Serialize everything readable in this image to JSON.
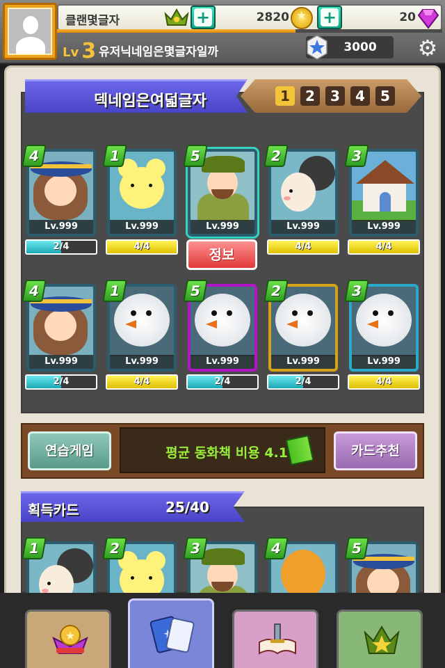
{
  "header": {
    "clan_name": "클랜몇글자",
    "gold": "2820",
    "gems": "20",
    "level_label": "Lv",
    "level": "3",
    "nickname": "유저닉네임은몇글자일까",
    "rank_points": "3000",
    "xp_progress": 0.62,
    "icons": {
      "clan": "crown-icon",
      "add": "plus-icon",
      "gold": "coin-icon",
      "gems": "gem-icon",
      "rank": "rank-star-icon",
      "settings": "gear-icon"
    }
  },
  "deck": {
    "title": "덱네임은여덟글자",
    "tabs": [
      "1",
      "2",
      "3",
      "4",
      "5"
    ],
    "active_tab": "1",
    "cards": [
      {
        "cost": "4",
        "level": "Lv.999",
        "progress": "2/4",
        "progress_value": 0.5,
        "bar": "cyan",
        "frame": "default",
        "art": "witch"
      },
      {
        "cost": "1",
        "level": "Lv.999",
        "progress": "4/4",
        "progress_value": 1.0,
        "bar": "yellow",
        "frame": "default",
        "art": "bear"
      },
      {
        "cost": "5",
        "level": "Lv.999",
        "progress": "",
        "progress_value": 0,
        "bar": "none",
        "frame": "selected",
        "art": "hunter"
      },
      {
        "cost": "2",
        "level": "Lv.999",
        "progress": "4/4",
        "progress_value": 1.0,
        "bar": "yellow",
        "frame": "default",
        "art": "goat"
      },
      {
        "cost": "3",
        "level": "Lv.999",
        "progress": "4/4",
        "progress_value": 1.0,
        "bar": "yellow",
        "frame": "default",
        "art": "house"
      },
      {
        "cost": "4",
        "level": "Lv.999",
        "progress": "2/4",
        "progress_value": 0.5,
        "bar": "cyan",
        "frame": "default",
        "art": "witch"
      },
      {
        "cost": "1",
        "level": "Lv.999",
        "progress": "4/4",
        "progress_value": 1.0,
        "bar": "yellow",
        "frame": "default",
        "art": "snowman"
      },
      {
        "cost": "5",
        "level": "Lv.999",
        "progress": "2/4",
        "progress_value": 0.5,
        "bar": "cyan",
        "frame": "purple",
        "art": "snowman"
      },
      {
        "cost": "2",
        "level": "Lv.999",
        "progress": "2/4",
        "progress_value": 0.5,
        "bar": "cyan",
        "frame": "gold",
        "art": "snowman"
      },
      {
        "cost": "3",
        "level": "Lv.999",
        "progress": "4/4",
        "progress_value": 1.0,
        "bar": "yellow",
        "frame": "teal",
        "art": "snowman"
      }
    ],
    "info_button": "정보",
    "practice_button": "연습게임",
    "average_cost": "평균 동화책 비용 4.1",
    "recommend_button": "카드추천"
  },
  "acquired": {
    "title": "획득카드",
    "count": "25/40",
    "cards": [
      {
        "cost": "1",
        "art": "goat"
      },
      {
        "cost": "2",
        "art": "bear"
      },
      {
        "cost": "3",
        "art": "hunter"
      },
      {
        "cost": "4",
        "art": "orange"
      },
      {
        "cost": "5",
        "art": "witch"
      }
    ]
  },
  "bottom_nav": [
    {
      "icon": "shop-coin-icon",
      "color": "#c8a878",
      "active": false
    },
    {
      "icon": "cards-icon",
      "color": "#7a86d8",
      "active": true
    },
    {
      "icon": "storybook-icon",
      "color": "#d8a0c8",
      "active": false
    },
    {
      "icon": "crown-star-icon",
      "color": "#88b878",
      "active": false
    }
  ],
  "colors": {
    "gold_accent": "#f5c33a",
    "banner_blue": "#5a55d8",
    "cost_green": "#4ac030",
    "info_red": "#e85050"
  }
}
